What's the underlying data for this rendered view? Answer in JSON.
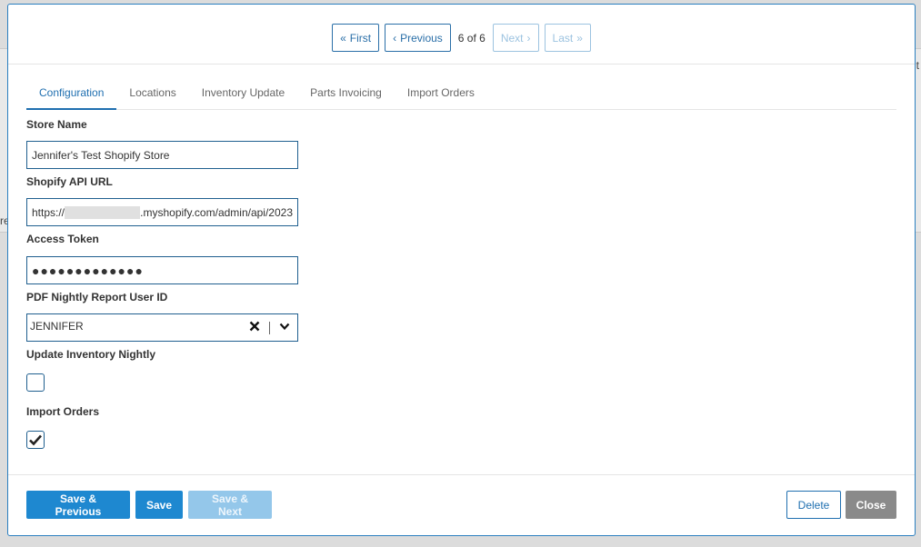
{
  "background": {
    "left_snippet": "re",
    "right_snippet": "it"
  },
  "pager": {
    "first": "First",
    "previous": "Previous",
    "count": "6 of 6",
    "next": "Next",
    "last": "Last"
  },
  "tabs": [
    {
      "label": "Configuration",
      "active": true
    },
    {
      "label": "Locations",
      "active": false
    },
    {
      "label": "Inventory Update",
      "active": false
    },
    {
      "label": "Parts Invoicing",
      "active": false
    },
    {
      "label": "Import Orders",
      "active": false
    }
  ],
  "form": {
    "store_name": {
      "label": "Store Name",
      "value": "Jennifer's Test Shopify Store"
    },
    "api_url": {
      "label": "Shopify API URL",
      "value_prefix": "https://",
      "value_suffix": ".myshopify.com/admin/api/2023"
    },
    "access_token": {
      "label": "Access Token",
      "value": "●●●●●●●●●●●●●"
    },
    "pdf_user": {
      "label": "PDF Nightly Report User ID",
      "value": "JENNIFER"
    },
    "update_inventory": {
      "label": "Update Inventory Nightly",
      "checked": false
    },
    "import_orders": {
      "label": "Import Orders",
      "checked": true
    }
  },
  "footer": {
    "save_previous": "Save & Previous",
    "save": "Save",
    "save_next": "Save & Next",
    "delete": "Delete",
    "close": "Close"
  },
  "colors": {
    "accent": "#1e88d0",
    "border": "#1f5f8f",
    "disabled": "#94c7ea",
    "close": "#8a8a8a"
  },
  "icons": [
    "double-chevron-left-icon",
    "chevron-left-icon",
    "chevron-right-icon",
    "double-chevron-right-icon",
    "clear-x-icon",
    "chevron-down-icon",
    "checkmark-icon"
  ]
}
